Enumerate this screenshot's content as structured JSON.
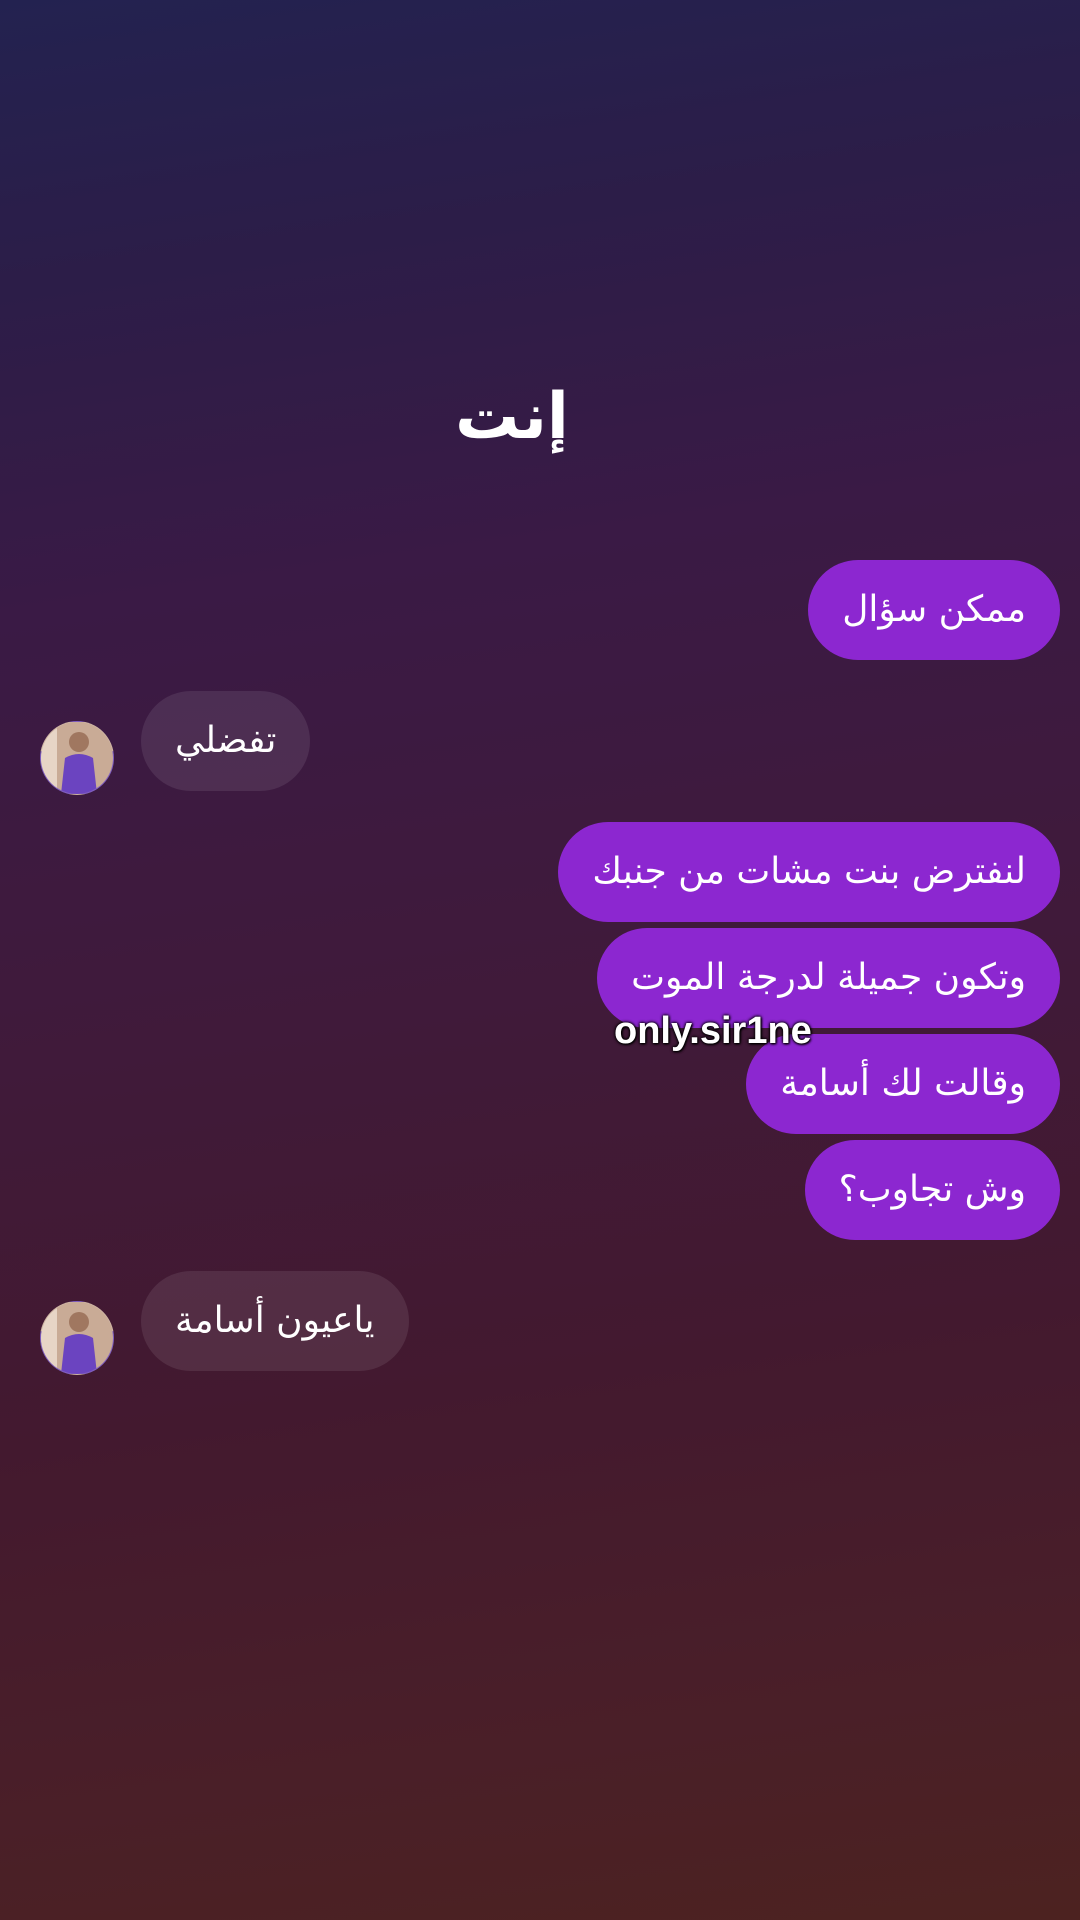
{
  "header": {
    "title": "إنت"
  },
  "messages": [
    {
      "side": "outgoing",
      "text": "ممكن سؤال"
    },
    {
      "side": "incoming",
      "text": "تفضلي"
    },
    {
      "side": "outgoing",
      "text": "لنفترض بنت مشات من جنبك"
    },
    {
      "side": "outgoing",
      "text": "وتكون جميلة لدرجة الموت"
    },
    {
      "side": "outgoing",
      "text": "وقالت لك أسامة"
    },
    {
      "side": "outgoing",
      "text": "وش تجاوب؟"
    },
    {
      "side": "incoming",
      "text": "ياعيون أسامة"
    }
  ],
  "watermark": "only.sir1ne",
  "colors": {
    "outgoing_bubble": "#8c27d0",
    "incoming_bubble": "rgba(255,255,255,0.09)",
    "background_top": "#232250",
    "background_bottom": "#4c2220"
  },
  "icons": {
    "avatar": "contact-avatar-photo"
  }
}
